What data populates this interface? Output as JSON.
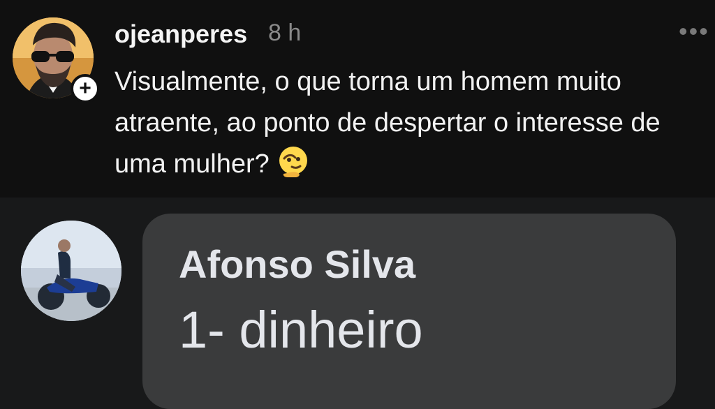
{
  "post": {
    "username": "ojeanperes",
    "time": "8 h",
    "more_icon": "•••",
    "text": "Visualmente, o que torna um homem muito atraente, ao ponto de despertar o interesse de uma mulher?",
    "emoji": "thinking-face-icon",
    "follow_symbol": "+"
  },
  "comment": {
    "author": "Afonso Silva",
    "text": "1- dinheiro"
  },
  "colors": {
    "post_background": "#101010",
    "comment_background": "#18191a",
    "bubble": "#3a3b3c",
    "primary_text": "#f2f2f2",
    "secondary_text": "#8a8a8a"
  }
}
